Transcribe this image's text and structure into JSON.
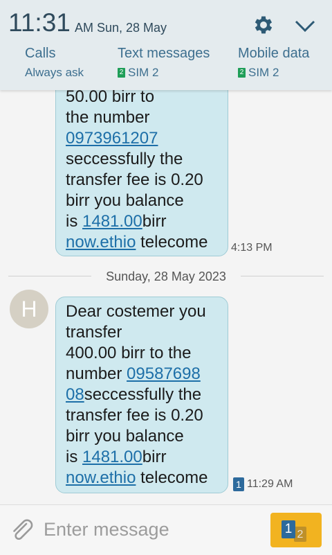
{
  "status": {
    "time": "11:31",
    "ampm_date": "AM Sun, 28 May"
  },
  "quick_settings": {
    "calls": {
      "title": "Calls",
      "value": "Always ask"
    },
    "text_messages": {
      "title": "Text messages",
      "sim_number": "2",
      "value": "SIM 2"
    },
    "mobile_data": {
      "title": "Mobile data",
      "sim_number": "2",
      "value": "SIM 2"
    }
  },
  "messages": [
    {
      "lines": [
        "50.00 birr to",
        "the number"
      ],
      "number": "0973961207",
      "rest_lines": [
        "seccessfully the",
        "transfer fee is 0.20",
        "birr you balance"
      ],
      "balance_prefix": "is ",
      "balance": "1481.00",
      "balance_suffix": "birr",
      "link": "now.ethio",
      "link_suffix": " telecome",
      "time": "4:13 PM"
    },
    {
      "lines": [
        " Dear costemer you",
        "transfer",
        "400.00 birr to the"
      ],
      "number_prefix": "number ",
      "number_part1": "09587698",
      "number_part2": "08",
      "number_suffix": "seccessfully the",
      "rest_lines": [
        "transfer fee is 0.20",
        "birr you balance"
      ],
      "balance_prefix": "is ",
      "balance": "1481.00",
      "balance_suffix": "birr",
      "link": "now.ethio",
      "link_suffix": " telecome",
      "sim": "1",
      "time": "11:29 AM"
    }
  ],
  "date_separator": "Sunday, 28 May 2023",
  "avatar_letter": "H",
  "composer": {
    "placeholder": "Enter message",
    "send_sim1": "1",
    "send_sim2": "2"
  },
  "colors": {
    "bubble": "#cfe9ef",
    "link": "#1d6fa8",
    "send_button": "#f2b320",
    "sim_badge": "#2d6a9c"
  }
}
